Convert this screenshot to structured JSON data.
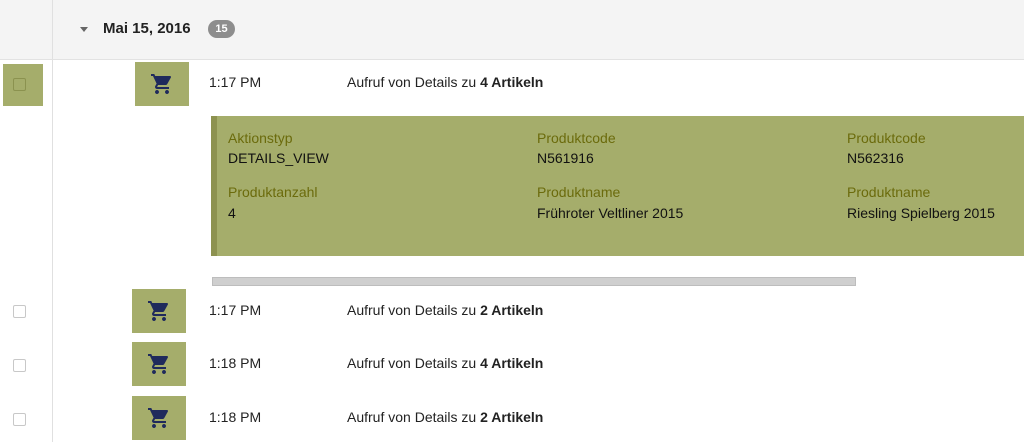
{
  "group": {
    "date": "Mai 15, 2016",
    "count": "15"
  },
  "events": [
    {
      "time": "1:17 PM",
      "desc_prefix": "Aufruf von Details zu ",
      "desc_bold": "4 Artikeln",
      "icon": "cart-icon",
      "selected": true
    },
    {
      "time": "1:17 PM",
      "desc_prefix": "Aufruf von Details zu ",
      "desc_bold": "2 Artikeln",
      "icon": "cart-icon",
      "selected": false
    },
    {
      "time": "1:18 PM",
      "desc_prefix": "Aufruf von Details zu ",
      "desc_bold": "4 Artikeln",
      "icon": "cart-icon",
      "selected": false
    },
    {
      "time": "1:18 PM",
      "desc_prefix": "Aufruf von Details zu ",
      "desc_bold": "2 Artikeln",
      "icon": "cart-icon",
      "selected": false
    }
  ],
  "details": {
    "action_type_label": "Aktionstyp",
    "action_type_value": "DETAILS_VIEW",
    "product_count_label": "Produktanzahl",
    "product_count_value": "4",
    "products": [
      {
        "code_label": "Produktcode",
        "code": "N561916",
        "name_label": "Produktname",
        "name": "Frühroter Veltliner 2015"
      },
      {
        "code_label": "Produktcode",
        "code": "N562316",
        "name_label": "Produktname",
        "name": "Riesling Spielberg 2015"
      }
    ]
  },
  "colors": {
    "accent": "#a5ad6b",
    "label": "#6b6b0c",
    "icon": "#1f2a5c"
  }
}
